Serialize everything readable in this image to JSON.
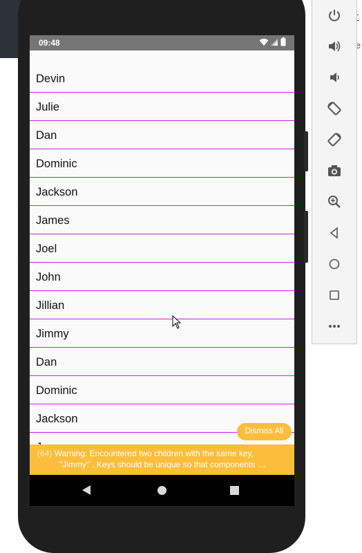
{
  "background": {
    "right_edge_glyph_top": "Σ",
    "right_edge_text": "le"
  },
  "status_bar": {
    "time": "09:48",
    "icons": [
      "wifi-icon",
      "signal-icon",
      "battery-icon"
    ]
  },
  "list": {
    "items": [
      "Devin",
      "Julie",
      "Dan",
      "Dominic",
      "Jackson",
      "James",
      "Joel",
      "John",
      "Jillian",
      "Jimmy",
      "Dan",
      "Dominic",
      "Jackson",
      "Ja"
    ]
  },
  "warning": {
    "dismiss_label": "Dismiss All",
    "count": "(64)",
    "line1": "Warning: Encountered two children with the same key,",
    "line2": "`\"Jimmy\"`. Keys should be unique so that components …"
  },
  "nav_bar": {
    "buttons": [
      "back",
      "home",
      "recents"
    ]
  },
  "emulator_toolbar": {
    "buttons": [
      "power-icon",
      "volume-up-icon",
      "volume-down-icon",
      "rotate-left-icon",
      "rotate-right-icon",
      "camera-icon",
      "zoom-icon",
      "back-icon",
      "home-icon",
      "overview-icon",
      "more-icon"
    ]
  },
  "colors": {
    "divider": "#d11fe0",
    "warning_bg": "#fbbd3b",
    "status_bar_bg": "#757575",
    "screen_bg": "#fafafa"
  }
}
